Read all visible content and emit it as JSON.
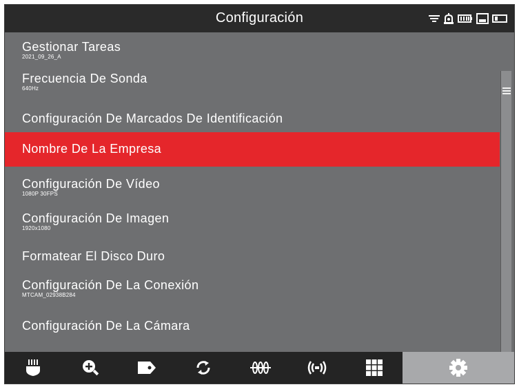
{
  "header": {
    "title": "Configuración"
  },
  "status_icons": [
    "wifi-icon",
    "alarm-icon",
    "battery-icon",
    "storage-icon",
    "card-icon"
  ],
  "menu": {
    "items": [
      {
        "label": "Gestionar Tareas",
        "sub": "2021_09_26_A"
      },
      {
        "label": "Frecuencia De Sonda",
        "sub": "640Hz"
      },
      {
        "label": "Configuración De Marcados De Identificación",
        "sub": ""
      },
      {
        "label": "Nombre De La Empresa",
        "sub": "",
        "selected": true
      },
      {
        "label": "Configuración De Vídeo",
        "sub": "1080P 30FPS"
      },
      {
        "label": "Configuración De Imagen",
        "sub": "1920x1080"
      },
      {
        "label": "Formatear El Disco Duro",
        "sub": ""
      },
      {
        "label": "Configuración De La Conexión",
        "sub": "MTCAM_02938B284"
      },
      {
        "label": "Configuración De La Cámara",
        "sub": ""
      }
    ]
  },
  "colors": {
    "background": "#6e6f71",
    "header": "#2a2a2a",
    "selected": "#e5262b",
    "toolbar": "#242424",
    "toolbar_active": "#a8a9ab"
  },
  "toolbar": {
    "tools": [
      "light-icon",
      "zoom-in-icon",
      "tag-icon",
      "rotate-icon",
      "sonde-icon",
      "signal-icon",
      "grid-icon",
      "settings-icon"
    ],
    "active": "settings-icon"
  }
}
